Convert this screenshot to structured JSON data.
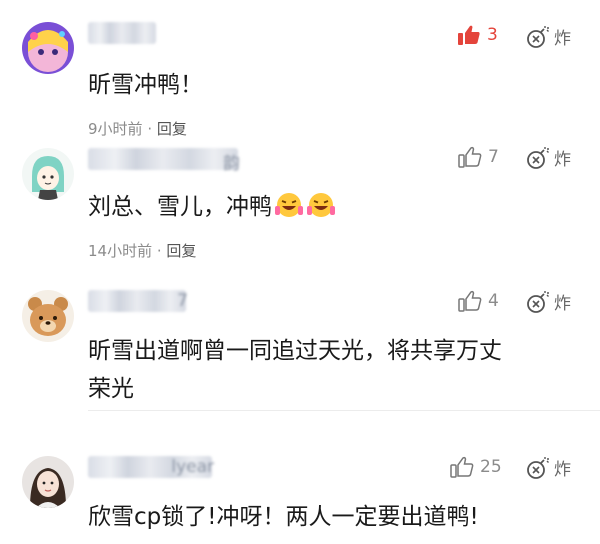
{
  "comments": [
    {
      "text": "昕雪冲鸭！",
      "time": "9小时前",
      "reply_label": "回复",
      "likes": "3",
      "bomb_label": "炸",
      "liked": true
    },
    {
      "text": "刘总、雪儿，冲鸭",
      "time": "14小时前",
      "reply_label": "回复",
      "likes": "7",
      "bomb_label": "炸",
      "username_tail": "韵"
    },
    {
      "text_line1": "昕雪出道啊曾一同追过天光，将共享万丈",
      "text_line2": "荣光",
      "likes": "4",
      "bomb_label": "炸",
      "username_tail": "7"
    },
    {
      "text": "欣雪cp锁了!冲呀！两人一定要出道鸭!",
      "likes": "25",
      "bomb_label": "炸",
      "username_tail": "lyear"
    }
  ],
  "colors": {
    "liked": "#e4443b",
    "muted": "#8b8b8b"
  },
  "icons": {
    "like": "thumbs-up-icon",
    "bomb": "bomb-icon"
  }
}
